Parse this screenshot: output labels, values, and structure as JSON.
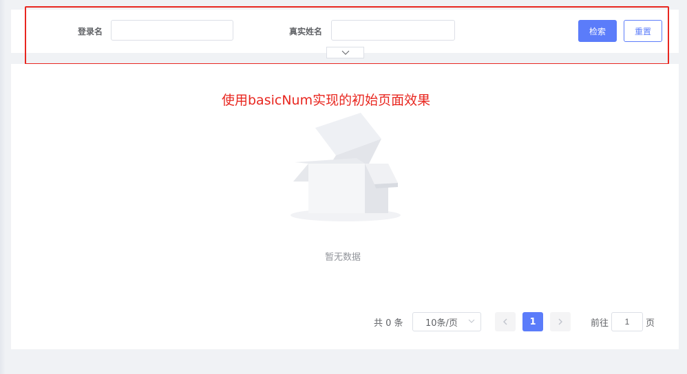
{
  "search": {
    "login_label": "登录名",
    "login_value": "",
    "realname_label": "真实姓名",
    "realname_value": "",
    "search_button": "检索",
    "reset_button": "重置",
    "toggle_icon": "chevron-down-icon"
  },
  "annotation": "使用basicNum实现的初始页面效果",
  "table": {
    "empty_text": "暂无数据",
    "empty_icon": "empty-box-icon"
  },
  "pagination": {
    "total": "共 0 条",
    "page_size": "10条/页",
    "current_page": "1",
    "goto_label": "前往",
    "goto_value": "1",
    "page_suffix": "页"
  },
  "colors": {
    "primary": "#5b7cfa",
    "annotation_red": "#e8261f"
  }
}
